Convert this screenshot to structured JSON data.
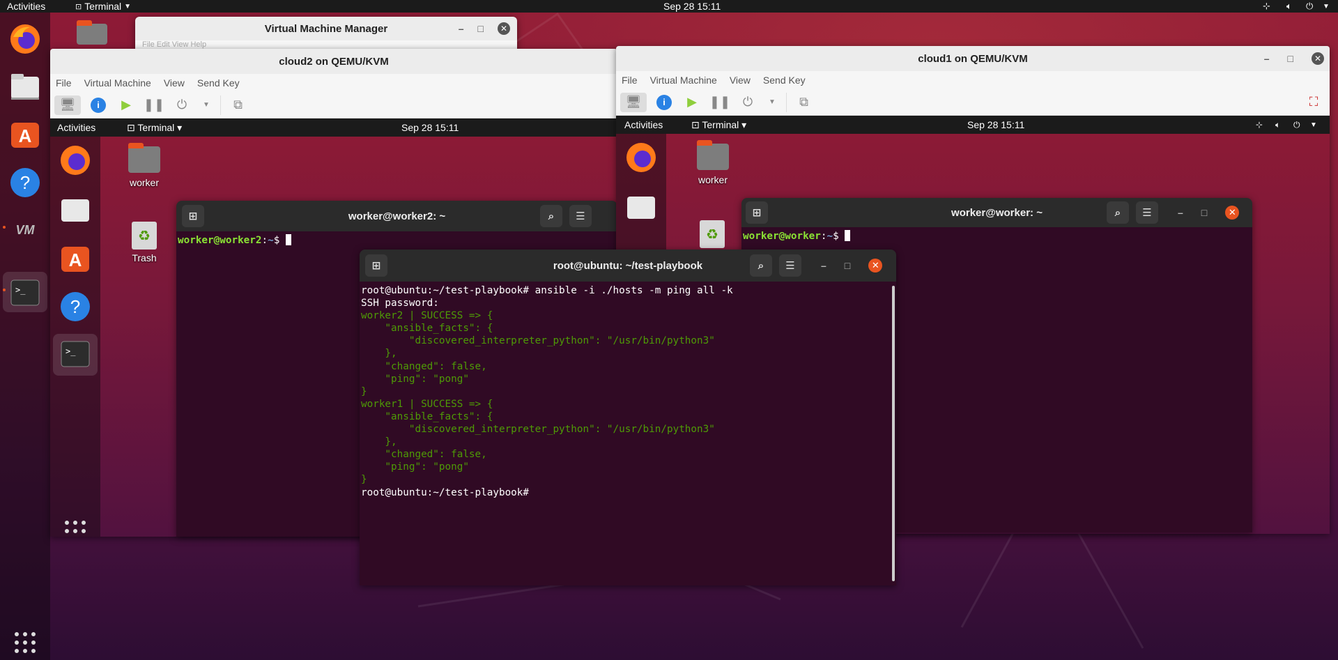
{
  "topbar": {
    "activities": "Activities",
    "app": "Terminal",
    "clock": "Sep 28  15:11"
  },
  "vmm": {
    "title": "Virtual Machine Manager",
    "menu_hint": "File  Edit  View  Help"
  },
  "cloud2": {
    "title": "cloud2 on QEMU/KVM",
    "menu": [
      "File",
      "Virtual Machine",
      "View",
      "Send Key"
    ],
    "guest": {
      "activities": "Activities",
      "app": "Terminal",
      "clock": "Sep 28  15:11"
    },
    "desktop": {
      "home": "worker",
      "trash": "Trash"
    },
    "terminal": {
      "title": "worker@worker2: ~",
      "prompt_user": "worker@worker2",
      "prompt_path": "~",
      "prompt_sym": "$"
    }
  },
  "cloud1": {
    "title": "cloud1 on QEMU/KVM",
    "menu": [
      "File",
      "Virtual Machine",
      "View",
      "Send Key"
    ],
    "guest": {
      "activities": "Activities",
      "app": "Terminal",
      "clock": "Sep 28  15:11"
    },
    "desktop": {
      "home": "worker"
    },
    "terminal": {
      "title": "worker@worker: ~",
      "prompt_user": "worker@worker",
      "prompt_path": "~",
      "prompt_sym": "$"
    }
  },
  "main_terminal": {
    "title": "root@ubuntu: ~/test-playbook",
    "lines": [
      {
        "t": "root@ubuntu:~/test-playbook# ansible -i ./hosts -m ping all -k",
        "c": ""
      },
      {
        "t": "SSH password:",
        "c": ""
      },
      {
        "t": "worker2 | SUCCESS => {",
        "c": "g"
      },
      {
        "t": "    \"ansible_facts\": {",
        "c": "g"
      },
      {
        "t": "        \"discovered_interpreter_python\": \"/usr/bin/python3\"",
        "c": "g"
      },
      {
        "t": "    },",
        "c": "g"
      },
      {
        "t": "    \"changed\": false,",
        "c": "g"
      },
      {
        "t": "    \"ping\": \"pong\"",
        "c": "g"
      },
      {
        "t": "}",
        "c": "g"
      },
      {
        "t": "worker1 | SUCCESS => {",
        "c": "g"
      },
      {
        "t": "    \"ansible_facts\": {",
        "c": "g"
      },
      {
        "t": "        \"discovered_interpreter_python\": \"/usr/bin/python3\"",
        "c": "g"
      },
      {
        "t": "    },",
        "c": "g"
      },
      {
        "t": "    \"changed\": false,",
        "c": "g"
      },
      {
        "t": "    \"ping\": \"pong\"",
        "c": "g"
      },
      {
        "t": "}",
        "c": "g"
      },
      {
        "t": "root@ubuntu:~/test-playbook# ",
        "c": ""
      }
    ]
  },
  "colors": {
    "ubuntu_orange": "#e95420",
    "terminal_bg": "#300a24",
    "ansible_green": "#4e9a06"
  }
}
